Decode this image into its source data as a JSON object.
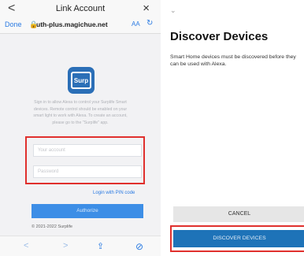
{
  "left": {
    "topbar": {
      "back": "<",
      "title": "Link Account",
      "close": "×"
    },
    "urlbar": {
      "done": "Done",
      "lock": "🔒",
      "url": "uth-plus.magichue.net",
      "aa": "AA",
      "reload": "↻"
    },
    "logo_text": "Surp",
    "description": "Sign in to allow Alexa to control your Surplife Smart devices. Remote control should be enabled on your smart light to work with Alexa. To create an account, please go to the \"Surplife\" app.",
    "account_placeholder": "Your account",
    "password_placeholder": "Password",
    "pin_link": "Login with PIN code",
    "authorize": "Authorize",
    "copyright": "© 2021-2022 Surplife",
    "nav": {
      "back": "<",
      "forward": ">",
      "share": "⇪",
      "compass": "⊘"
    }
  },
  "right": {
    "chevron": "⌄",
    "heading": "Discover Devices",
    "description": "Smart Home devices must be discovered before they can be used with Alexa.",
    "cancel": "CANCEL",
    "discover": "DISCOVER DEVICES"
  },
  "colors": {
    "accent": "#2a7ae2",
    "highlight": "#e0302d",
    "primary_button": "#1e73b8"
  }
}
